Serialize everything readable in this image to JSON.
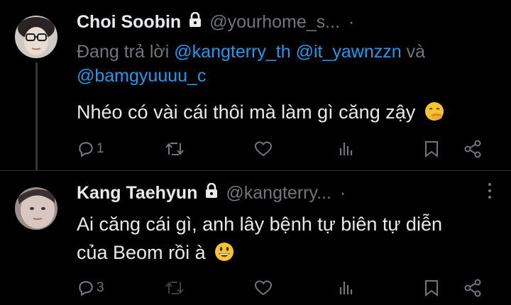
{
  "tweets": [
    {
      "name": "Choi Soobin",
      "handle": "@yourhome_s...",
      "time_sep": "·",
      "reply_prefix": "Đang trả lời ",
      "mentions": [
        "@kangterry_th",
        "@it_yawnzzn",
        "@bamgyuuuu_c"
      ],
      "reply_join": " và",
      "text": "Nhéo có vài cái thôi mà làm gì căng zậy",
      "emoji": "hand-over-mouth-emoji",
      "reply_count": "1",
      "icons": [
        "reply-icon",
        "retweet-icon",
        "like-icon",
        "views-icon",
        "bookmark-icon",
        "share-icon"
      ]
    },
    {
      "name": "Kang Taehyun",
      "handle": "@kangterry...",
      "time_sep": "·",
      "text_line1": "Ai căng cái gì, anh lây bệnh tự biên tự diễn",
      "text_line2": "của Beom rồi à",
      "emoji": "grinning-face-emoji",
      "reply_count": "3",
      "icons": [
        "reply-icon",
        "retweet-icon",
        "like-icon",
        "views-icon",
        "bookmark-icon",
        "share-icon"
      ]
    }
  ],
  "colors": {
    "background": "#000000",
    "text": "#e7e9ea",
    "muted": "#71767b",
    "link": "#1d9bf0",
    "divider": "#2f3336"
  }
}
